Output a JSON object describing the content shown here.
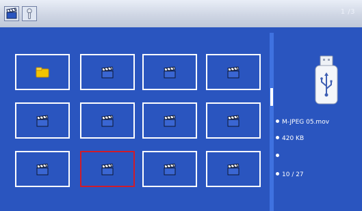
{
  "topbar": {
    "video_mode_icon": "film-clapper-icon",
    "tool_icon": "wrench-icon",
    "page_indicator": "1 /3"
  },
  "grid": {
    "thumbnails": [
      {
        "type": "folder",
        "icon": "folder-icon"
      },
      {
        "type": "video",
        "icon": "film-clapper-icon"
      },
      {
        "type": "video",
        "icon": "film-clapper-icon"
      },
      {
        "type": "video",
        "icon": "film-clapper-icon"
      },
      {
        "type": "video",
        "icon": "film-clapper-icon"
      },
      {
        "type": "video",
        "icon": "film-clapper-icon"
      },
      {
        "type": "video",
        "icon": "film-clapper-icon"
      },
      {
        "type": "video",
        "icon": "film-clapper-icon"
      },
      {
        "type": "video",
        "icon": "film-clapper-icon"
      },
      {
        "type": "video",
        "icon": "film-clapper-icon",
        "selected": true
      },
      {
        "type": "video",
        "icon": "film-clapper-icon"
      },
      {
        "type": "video",
        "icon": "film-clapper-icon"
      }
    ],
    "selected_index": 9
  },
  "scrollbar": {
    "position_fraction": 0.31
  },
  "info": {
    "device_icon": "usb-drive-icon",
    "file_name": "M-JPEG  05.mov",
    "file_size": "420  KB",
    "resolution": "",
    "counter": "10  /  27"
  },
  "colors": {
    "background": "#2a55bf",
    "topbar": "#cfd6e4",
    "thumb_border": "#ffffff",
    "selection_border": "#d01c2a",
    "scroll_track": "#3f72e0"
  }
}
